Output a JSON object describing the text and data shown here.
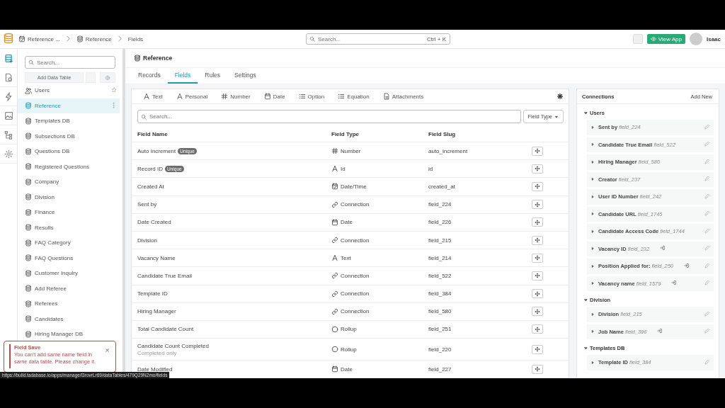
{
  "top_bar": {
    "breadcrumbs": [
      "Reference ...",
      "Reference",
      "Fields"
    ],
    "search": {
      "placeholder": "Search...",
      "shortcut": "Ctrl + K"
    },
    "view_app": "View App",
    "user": "Isaac"
  },
  "rail": [
    {
      "selected": true
    },
    {
      "selected": false
    },
    {
      "selected": false
    },
    {
      "selected": false
    },
    {
      "selected": false
    },
    {
      "selected": false
    }
  ],
  "sidebar": {
    "search": {
      "placeholder": "Search..."
    },
    "add_button": "Add Data Table",
    "items": [
      {
        "label": "Users",
        "kind": "users",
        "selected": false
      },
      {
        "label": "Reference",
        "kind": "table",
        "selected": true
      },
      {
        "label": "Templates DB",
        "kind": "table",
        "selected": false
      },
      {
        "label": "Subsections DB",
        "kind": "table",
        "selected": false
      },
      {
        "label": "Questions DB",
        "kind": "table",
        "selected": false
      },
      {
        "label": "Registered Questions",
        "kind": "table",
        "selected": false
      },
      {
        "label": "Company",
        "kind": "table",
        "selected": false
      },
      {
        "label": "Division",
        "kind": "table",
        "selected": false
      },
      {
        "label": "Finance",
        "kind": "table",
        "selected": false
      },
      {
        "label": "Results",
        "kind": "table",
        "selected": false
      },
      {
        "label": "FAQ Category",
        "kind": "table",
        "selected": false
      },
      {
        "label": "FAQ Questions",
        "kind": "table",
        "selected": false
      },
      {
        "label": "Customer Inquiry",
        "kind": "table",
        "selected": false
      },
      {
        "label": "Add Referee",
        "kind": "table",
        "selected": false
      },
      {
        "label": "Referees",
        "kind": "table",
        "selected": false
      },
      {
        "label": "Candidates",
        "kind": "table",
        "selected": false
      },
      {
        "label": "Hiring Manager DB",
        "kind": "table",
        "selected": false
      }
    ]
  },
  "page": {
    "title": "Reference",
    "tabs": [
      {
        "label": "Records",
        "selected": false
      },
      {
        "label": "Fields",
        "selected": true
      },
      {
        "label": "Rules",
        "selected": false
      },
      {
        "label": "Settings",
        "selected": false
      }
    ]
  },
  "field_types": [
    "Text",
    "Personal",
    "Number",
    "Date",
    "Option",
    "Equation",
    "Attachments"
  ],
  "table": {
    "search": {
      "placeholder": "Search..."
    },
    "filter": "Field Type",
    "columns": [
      "Field Name",
      "Field Type",
      "Field Slug"
    ],
    "rows": [
      {
        "name": "Auto Increment",
        "badge": "Unique",
        "type": "Number",
        "kind": "number",
        "slug": "auto_increment"
      },
      {
        "name": "Record ID",
        "badge": "Unique",
        "type": "Id",
        "kind": "text",
        "slug": "id"
      },
      {
        "name": "Created At",
        "type": "Date/Time",
        "kind": "datetime",
        "slug": "created_at"
      },
      {
        "name": "Sent by",
        "type": "Connection",
        "kind": "connection",
        "slug": "field_224"
      },
      {
        "name": "Date Created",
        "type": "Date",
        "kind": "date",
        "slug": "field_226"
      },
      {
        "name": "Division",
        "type": "Connection",
        "kind": "connection",
        "slug": "field_215"
      },
      {
        "name": "Vacancy Name",
        "type": "Text",
        "kind": "text",
        "slug": "field_214"
      },
      {
        "name": "Candidate True Email",
        "type": "Connection",
        "kind": "connection",
        "slug": "field_522"
      },
      {
        "name": "Template ID",
        "type": "Connection",
        "kind": "connection",
        "slug": "field_384"
      },
      {
        "name": "Hiring Manager",
        "type": "Connection",
        "kind": "connection",
        "slug": "field_580"
      },
      {
        "name": "Total Candidate Count",
        "type": "Rollup",
        "kind": "rollup",
        "slug": "field_251"
      },
      {
        "name": "Candidate Count Completed",
        "note": "Completed only",
        "type": "Rollup",
        "kind": "rollup",
        "slug": "field_220"
      },
      {
        "name": "Date Modified",
        "type": "Date",
        "kind": "date",
        "slug": "field_227"
      }
    ]
  },
  "connections": {
    "title": "Connections",
    "add": "Add New",
    "groups": [
      {
        "name": "Users",
        "expanded": true,
        "items": [
          {
            "name": "Sent by",
            "slug": "field_224",
            "linked": false
          },
          {
            "name": "Candidate True Email",
            "slug": "field_522",
            "linked": false
          },
          {
            "name": "Hiring Manager",
            "slug": "field_580",
            "linked": false
          },
          {
            "name": "Creator",
            "slug": "field_237",
            "linked": false
          },
          {
            "name": "User ID Number",
            "slug": "field_242",
            "linked": false
          },
          {
            "name": "Candidate URL",
            "slug": "field_1745",
            "linked": false
          },
          {
            "name": "Candidate Access Code",
            "slug": "field_1744",
            "linked": false
          },
          {
            "name": "Vacancy ID",
            "slug": "field_232",
            "linked": true
          },
          {
            "name": "Position Applied for:",
            "slug": "field_250",
            "linked": true
          },
          {
            "name": "Vacancy name",
            "slug": "field_1579",
            "linked": true
          }
        ]
      },
      {
        "name": "Division",
        "expanded": true,
        "items": [
          {
            "name": "Division",
            "slug": "field_215",
            "linked": false
          },
          {
            "name": "Job Name",
            "slug": "field_396",
            "linked": true
          }
        ]
      },
      {
        "name": "Templates DB",
        "expanded": true,
        "items": [
          {
            "name": "Template ID",
            "slug": "field_384",
            "linked": false
          }
        ]
      }
    ]
  },
  "toast": {
    "title": "Field Save",
    "message": "You can't add same name field in same data table. Please change it."
  },
  "status_url": "https://build.tadabase.io/apps/manage/l3rovrLr69/dataTables/479Q29N2mo/fields"
}
